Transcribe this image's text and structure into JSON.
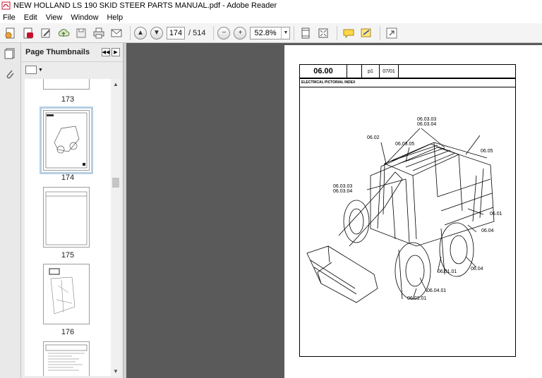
{
  "window": {
    "title": "NEW HOLLAND LS 190 SKID STEER  PARTS MANUAL.pdf - Adobe Reader"
  },
  "menu": [
    "File",
    "Edit",
    "View",
    "Window",
    "Help"
  ],
  "toolbar": {
    "current_page": "174",
    "total_pages": "/ 514",
    "zoom": "52.8%",
    "icons": [
      "create-pdf-icon",
      "acrobat-icon",
      "edit-icon",
      "cloud-upload-icon",
      "save-icon",
      "print-icon",
      "email-icon",
      "previous-page-icon",
      "next-page-icon",
      "zoom-out-icon",
      "zoom-in-icon",
      "fit-page-icon",
      "full-screen-icon",
      "comment-icon",
      "sign-icon",
      "expand-icon"
    ]
  },
  "sidebar": {
    "title": "Page Thumbnails",
    "thumbnails": [
      {
        "label": "173"
      },
      {
        "label": "174"
      },
      {
        "label": "175"
      },
      {
        "label": "176"
      },
      {
        "label": ""
      }
    ]
  },
  "document": {
    "section_code": "06.00",
    "page_ref": "p1",
    "date": "07/01",
    "subtitle": "ELECTRICAL PICTORIAL INDEX",
    "callouts": [
      "06.03.03",
      "06.03.04",
      "06.02",
      "06.03.05",
      "06.05",
      "06.03.03",
      "06.03.04",
      "06.01",
      "06.04",
      "06.04",
      "06.01.01",
      "06.04.01",
      "06.03.01"
    ]
  }
}
